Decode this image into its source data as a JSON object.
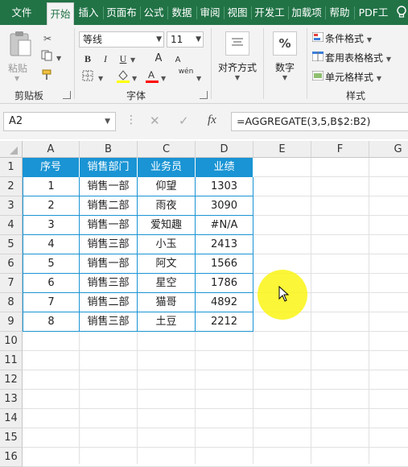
{
  "tabs": [
    "文件",
    "开始",
    "插入",
    "页面布",
    "公式",
    "数据",
    "审阅",
    "视图",
    "开发工",
    "加载项",
    "帮助",
    "PDF工"
  ],
  "active_tab": "开始",
  "clipboard": {
    "paste_label": "粘贴",
    "group_label": "剪贴板"
  },
  "font": {
    "name": "等线",
    "size": "11",
    "bold": "B",
    "italic": "I",
    "underline": "U",
    "grow": "A",
    "shrink": "A",
    "fill_color": "#ffff00",
    "font_color": "#ff0000",
    "phonetic": "wén",
    "group_label": "字体"
  },
  "alignment": {
    "label": "对齐方式"
  },
  "number": {
    "label": "数字",
    "symbol": "%"
  },
  "styles": {
    "conditional": "条件格式",
    "table_format": "套用表格格式",
    "cell_styles": "单元格样式",
    "group_label": "样式"
  },
  "formula_bar": {
    "name_box": "A2",
    "cancel": "✕",
    "enter": "✓",
    "fx": "fx",
    "formula": "=AGGREGATE(3,5,B$2:B2)"
  },
  "columns": [
    "A",
    "B",
    "C",
    "D",
    "E",
    "F",
    "G"
  ],
  "rows": [
    "1",
    "2",
    "3",
    "4",
    "5",
    "6",
    "7",
    "8",
    "9",
    "10",
    "11",
    "12",
    "13",
    "14",
    "15",
    "16"
  ],
  "table": {
    "headers": [
      "序号",
      "销售部门",
      "业务员",
      "业绩"
    ],
    "rows": [
      [
        "1",
        "销售一部",
        "仰望",
        "1303"
      ],
      [
        "2",
        "销售二部",
        "雨夜",
        "3090"
      ],
      [
        "3",
        "销售一部",
        "爱知趣",
        "#N/A"
      ],
      [
        "4",
        "销售三部",
        "小玉",
        "2413"
      ],
      [
        "5",
        "销售一部",
        "阿文",
        "1566"
      ],
      [
        "6",
        "销售三部",
        "星空",
        "1786"
      ],
      [
        "7",
        "销售二部",
        "猫哥",
        "4892"
      ],
      [
        "8",
        "销售三部",
        "土豆",
        "2212"
      ]
    ]
  },
  "colors": {
    "header_bg": "#1a94d4",
    "ribbon": "#217346",
    "highlight": "#faf514"
  }
}
